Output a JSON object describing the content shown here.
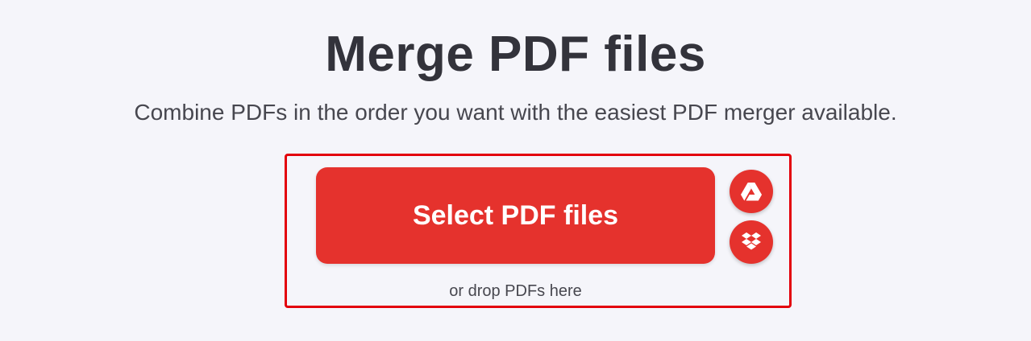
{
  "header": {
    "title": "Merge PDF files",
    "subtitle": "Combine PDFs in the order you want with the easiest PDF merger available."
  },
  "uploader": {
    "select_label": "Select PDF files",
    "drop_hint": "or drop PDFs here",
    "cloud_sources": [
      {
        "icon": "google-drive-icon"
      },
      {
        "icon": "dropbox-icon"
      }
    ]
  },
  "colors": {
    "accent": "#e5322d",
    "highlight_border": "#e3000b",
    "background": "#f5f5fa",
    "title_text": "#33333b"
  }
}
